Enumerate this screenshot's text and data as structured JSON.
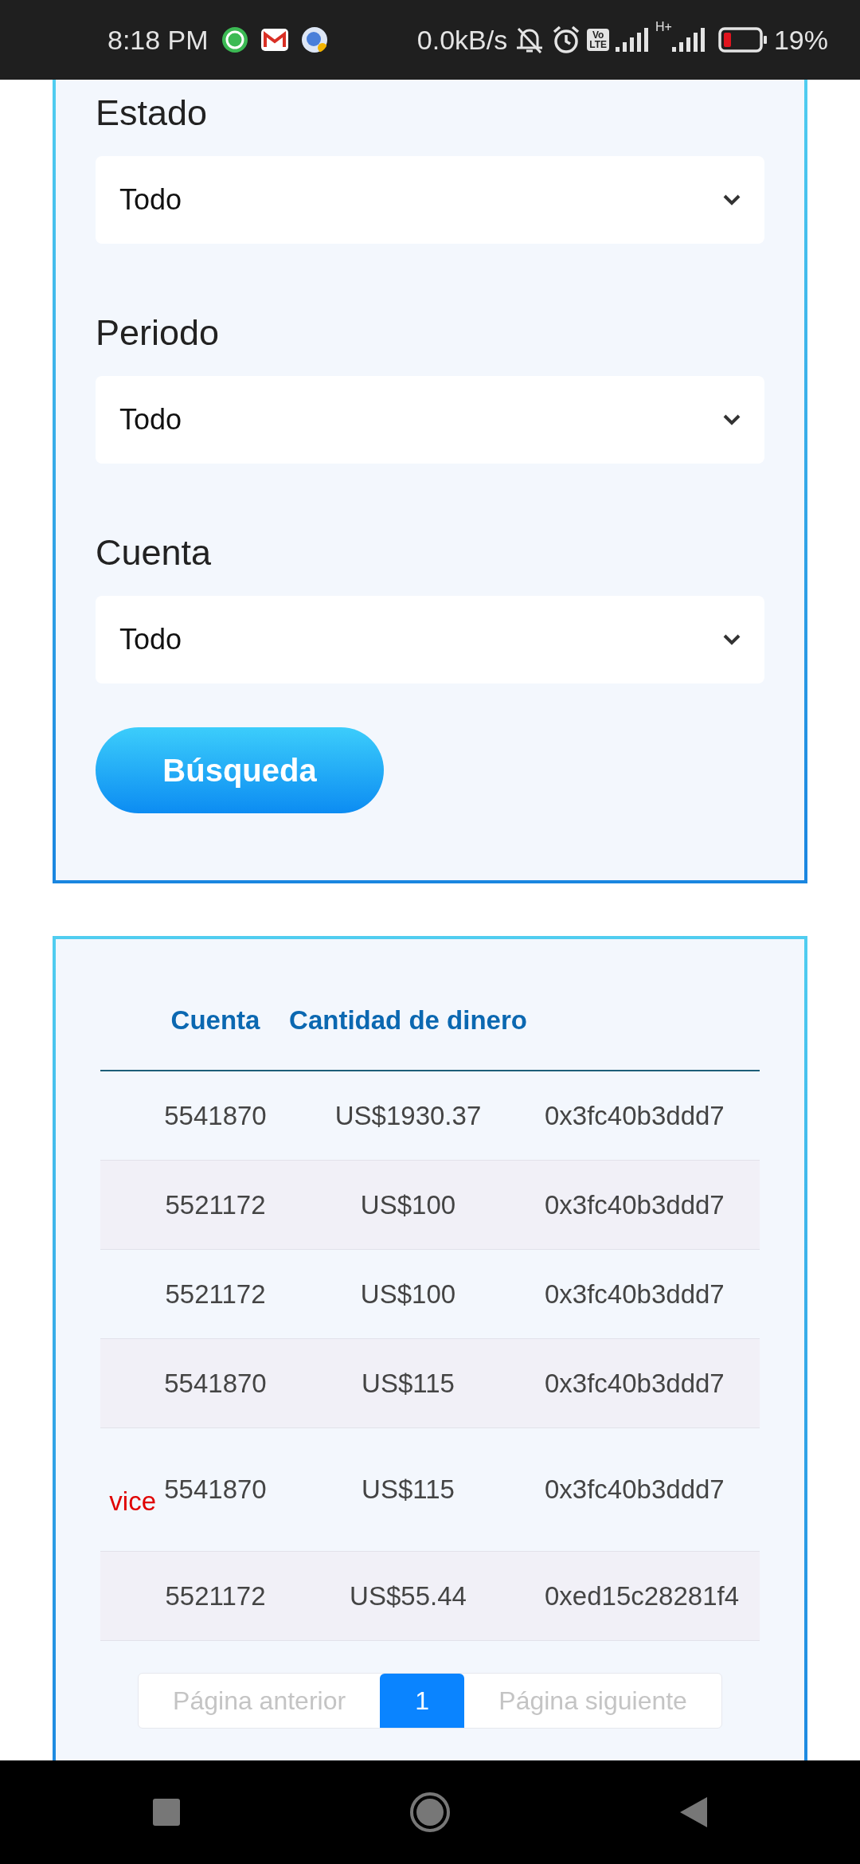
{
  "status_bar": {
    "time": "8:18 PM",
    "net_speed": "0.0kB/s",
    "volte": [
      "Vo",
      "LTE"
    ],
    "network_type": "H+",
    "battery_percent": "19%"
  },
  "filters": [
    {
      "label": "Estado",
      "value": "Todo"
    },
    {
      "label": "Periodo",
      "value": "Todo"
    },
    {
      "label": "Cuenta",
      "value": "Todo"
    }
  ],
  "search_button": "Búsqueda",
  "table": {
    "columns": [
      "Cuenta",
      "Cantidad de dinero"
    ],
    "rows": [
      {
        "cuenta": "5541870",
        "cantidad": "US$1930.37",
        "column_4": "0x3fc40b3ddd7"
      },
      {
        "cuenta": "5521172",
        "cantidad": "US$100",
        "column_4": "0x3fc40b3ddd7"
      },
      {
        "cuenta": "5521172",
        "cantidad": "US$100",
        "column_4": "0x3fc40b3ddd7"
      },
      {
        "cuenta": "5541870",
        "cantidad": "US$115",
        "column_4": "0x3fc40b3ddd7"
      },
      {
        "column_1": "vice",
        "cuenta": "5541870",
        "cantidad": "US$115",
        "column_4": "0x3fc40b3ddd7"
      },
      {
        "cuenta": "5521172",
        "cantidad": "US$55.44",
        "column_4": "0xed15c28281f4"
      }
    ]
  },
  "pagination": {
    "previous": "Página anterior",
    "pages": [
      {
        "label": "1",
        "selected": true
      }
    ],
    "next": "Página siguiente"
  }
}
